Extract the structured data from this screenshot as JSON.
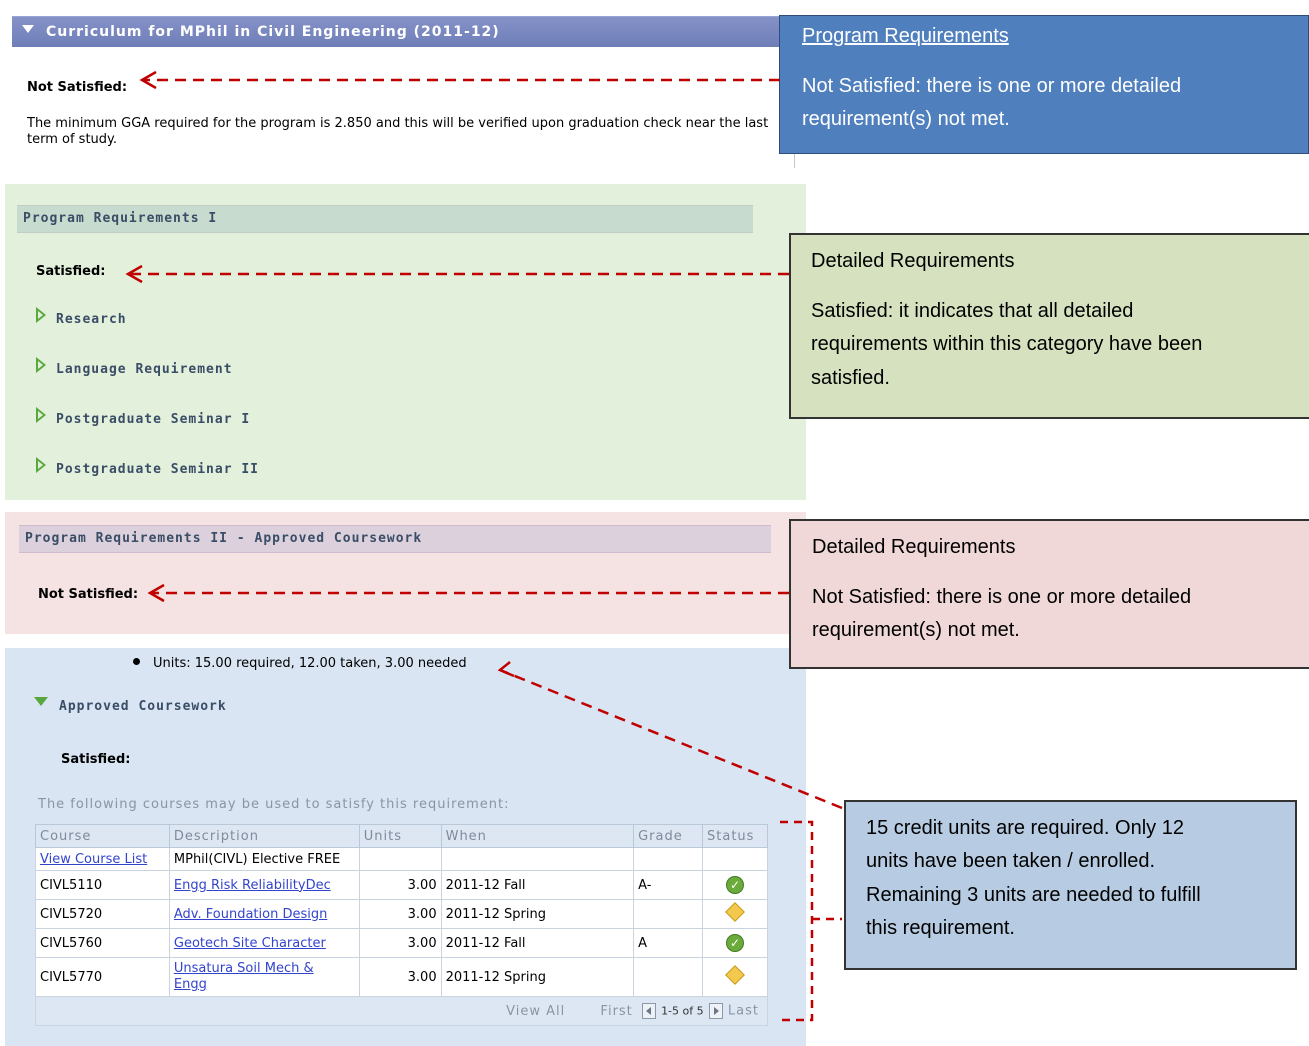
{
  "curriculum": {
    "title": "Curriculum for MPhil in Civil Engineering (2011-12)",
    "status": "Not Satisfied:",
    "note": "The minimum GGA required for the program is 2.850 and this will be verified upon graduation check near the last term of study."
  },
  "program_req_1": {
    "title": "Program Requirements I",
    "status": "Satisfied:",
    "items": [
      "Research",
      "Language Requirement",
      "Postgraduate Seminar I",
      "Postgraduate Seminar II"
    ]
  },
  "program_req_2": {
    "title": "Program Requirements II - Approved Coursework",
    "status": "Not Satisfied:"
  },
  "coursework": {
    "units_line": "Units: 15.00 required, 12.00 taken, 3.00 needed",
    "title": "Approved Coursework",
    "status": "Satisfied:",
    "intro": "The following courses may be used to satisfy this requirement:",
    "columns": [
      "Course",
      "Description",
      "Units",
      "When",
      "Grade",
      "Status"
    ],
    "first_row": {
      "course": "View Course List",
      "description": "MPhil(CIVL) Elective FREE"
    },
    "rows": [
      {
        "course": "CIVL5110",
        "description": "Engg Risk ReliabilityDec",
        "units": "3.00",
        "when": "2011-12 Fall",
        "grade": "A-",
        "status": "completed"
      },
      {
        "course": "CIVL5720",
        "description": "Adv. Foundation Design",
        "units": "3.00",
        "when": "2011-12 Spring",
        "grade": "",
        "status": "in-progress"
      },
      {
        "course": "CIVL5760",
        "description": "Geotech Site Character",
        "units": "3.00",
        "when": "2011-12 Fall",
        "grade": "A",
        "status": "completed"
      },
      {
        "course": "CIVL5770",
        "description": "Unsatura Soil Mech & Engg",
        "units": "3.00",
        "when": "2011-12 Spring",
        "grade": "",
        "status": "in-progress"
      }
    ],
    "nav": {
      "view_all": "View All",
      "first": "First",
      "range": "1-5 of 5",
      "last": "Last"
    }
  },
  "callouts": {
    "program": {
      "title": "Program Requirements",
      "l1": "Not Satisfied: there is one or more detailed",
      "l2": "requirement(s) not met."
    },
    "detailed_sat": {
      "title": "Detailed Requirements",
      "l1": "Satisfied: it indicates that all detailed",
      "l2": "requirements within this category have been",
      "l3": "satisfied."
    },
    "detailed_notsat": {
      "title": "Detailed Requirements",
      "l1": "Not Satisfied: there is one or more detailed",
      "l2": "requirement(s) not met."
    },
    "units": {
      "l1": "15 credit units are required.  Only 12",
      "l2": "units have been taken / enrolled.",
      "l3": "Remaining 3 units are needed to fulfill",
      "l4": "this requirement."
    }
  },
  "colors": {
    "header_bar": "#7786c0",
    "green_panel": "#e3f0dc",
    "pink_panel": "#f5e3e3",
    "blue_panel": "#d9e5f3",
    "arrow": "#c00000"
  }
}
